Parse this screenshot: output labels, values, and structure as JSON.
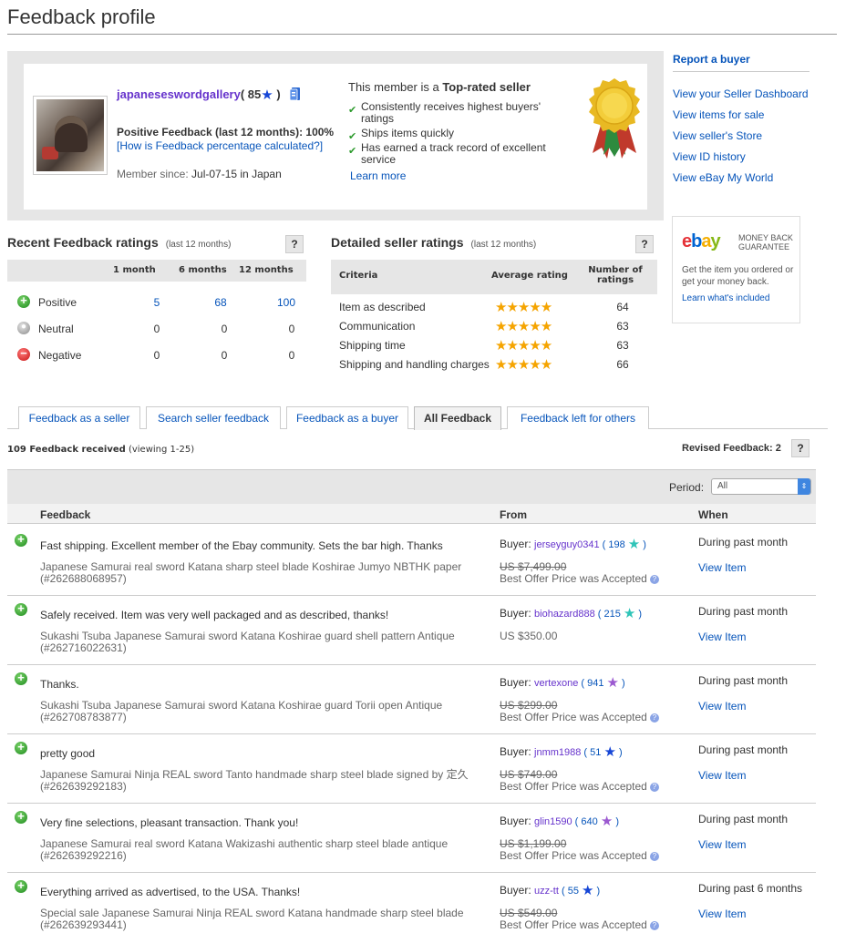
{
  "page": {
    "title": "Feedback profile"
  },
  "profile": {
    "seller_name": "japaneseswordgallery",
    "score_open": "( ",
    "score": "85",
    "score_close": " )",
    "positive_feedback": "Positive Feedback (last 12 months): 100%",
    "how_calculated": "[How is Feedback percentage calculated?]",
    "member_since_label": "Member since: ",
    "member_since_value": "Jul-07-15 in Japan"
  },
  "top_rated": {
    "head_prefix": "This member is a ",
    "head_bold": "Top-rated seller",
    "points": [
      "Consistently receives highest buyers' ratings",
      "Ships items quickly",
      "Has earned a track record of excellent service"
    ],
    "learn_more": "Learn more"
  },
  "sidebar": {
    "report_buyer": "Report a buyer",
    "links": [
      "View your Seller Dashboard",
      "View items for sale",
      "View seller's Store",
      "View ID history",
      "View eBay My World"
    ],
    "mbg": {
      "logo": [
        "e",
        "b",
        "a",
        "y"
      ],
      "tag": "MONEY BACK GUARANTEE",
      "text": "Get the item you ordered or get your money back.",
      "learn": "Learn what's included"
    }
  },
  "recent": {
    "title": "Recent Feedback ratings",
    "subtitle": "(last 12 months)",
    "help": "?",
    "columns": [
      "1 month",
      "6 months",
      "12 months"
    ],
    "rows": [
      {
        "label": "Positive",
        "values": [
          "5",
          "68",
          "100"
        ],
        "linked": true
      },
      {
        "label": "Neutral",
        "values": [
          "0",
          "0",
          "0"
        ],
        "linked": false
      },
      {
        "label": "Negative",
        "values": [
          "0",
          "0",
          "0"
        ],
        "linked": false
      }
    ]
  },
  "detailed": {
    "title": "Detailed seller ratings",
    "subtitle": "(last 12 months)",
    "help": "?",
    "col_criteria": "Criteria",
    "col_avg": "Average rating",
    "col_count": "Number of ratings",
    "rows": [
      {
        "criteria": "Item as described",
        "stars": 5,
        "count": "64"
      },
      {
        "criteria": "Communication",
        "stars": 5,
        "count": "63"
      },
      {
        "criteria": "Shipping time",
        "stars": 5,
        "count": "63"
      },
      {
        "criteria": "Shipping and handling charges",
        "stars": 5,
        "count": "66"
      }
    ]
  },
  "tabs": [
    {
      "label": "Feedback as a seller",
      "active": false
    },
    {
      "label": "Search seller feedback",
      "active": false
    },
    {
      "label": "Feedback as a buyer",
      "active": false
    },
    {
      "label": "All Feedback",
      "active": true
    },
    {
      "label": "Feedback left for others",
      "active": false
    }
  ],
  "list": {
    "count_bold": "109 Feedback received",
    "count_rest": " (viewing 1-25)",
    "revised": "Revised Feedback: 2",
    "help": "?",
    "period_label": "Period:",
    "period_value": "All",
    "headers": {
      "feedback": "Feedback",
      "from": "From",
      "when": "When"
    },
    "buyer_prefix": "Buyer: ",
    "view_item": "View Item",
    "rows": [
      {
        "comment": "Fast shipping. Excellent member of the Ebay community. Sets the bar high. Thanks",
        "item": "Japanese Samurai real sword Katana sharp steel blade Koshirae Jumyo NBTHK paper (#262688068957)",
        "buyer": "jerseyguy0341",
        "score": "198",
        "star_color": "#2fc4b8",
        "price": "US $7,499.00",
        "offer": "Best Offer Price was Accepted",
        "when": "During past month"
      },
      {
        "comment": "Safely received. Item was very well packaged and as described, thanks!",
        "item": "Sukashi Tsuba Japanese Samurai sword Katana Koshirae guard shell pattern Antique (#262716022631)",
        "buyer": "biohazard888",
        "score": "215",
        "star_color": "#2fc4b8",
        "price": "US $350.00",
        "offer": "",
        "when": "During past month"
      },
      {
        "comment": "Thanks.",
        "item": "Sukashi Tsuba Japanese Samurai sword Katana Koshirae guard Torii open Antique (#262708783877)",
        "buyer": "vertexone",
        "score": "941",
        "star_color": "#9b59d0",
        "price": "US $299.00",
        "offer": "Best Offer Price was Accepted",
        "when": "During past month"
      },
      {
        "comment": "pretty good",
        "item": "Japanese Samurai Ninja REAL sword Tanto handmade sharp steel blade signed by 定久 (#262639292183)",
        "buyer": "jnmm1988",
        "score": "51",
        "star_color": "#1646d6",
        "price": "US $749.00",
        "offer": "Best Offer Price was Accepted",
        "when": "During past month"
      },
      {
        "comment": "Very fine selections, pleasant transaction. Thank you!",
        "item": "Japanese Samurai real sword Katana Wakizashi authentic sharp steel blade antique (#262639292216)",
        "buyer": "glin1590",
        "score": "640",
        "star_color": "#9b59d0",
        "price": "US $1,199.00",
        "offer": "Best Offer Price was Accepted",
        "when": "During past month"
      },
      {
        "comment": "Everything arrived as advertised, to the USA. Thanks!",
        "item": "Special sale Japanese Samurai Ninja REAL sword Katana handmade sharp steel blade (#262639293441)",
        "buyer": "uzz-tt",
        "score": "55",
        "star_color": "#1646d6",
        "price": "US $549.00",
        "offer": "Best Offer Price was Accepted",
        "when": "During past 6 months"
      }
    ]
  }
}
